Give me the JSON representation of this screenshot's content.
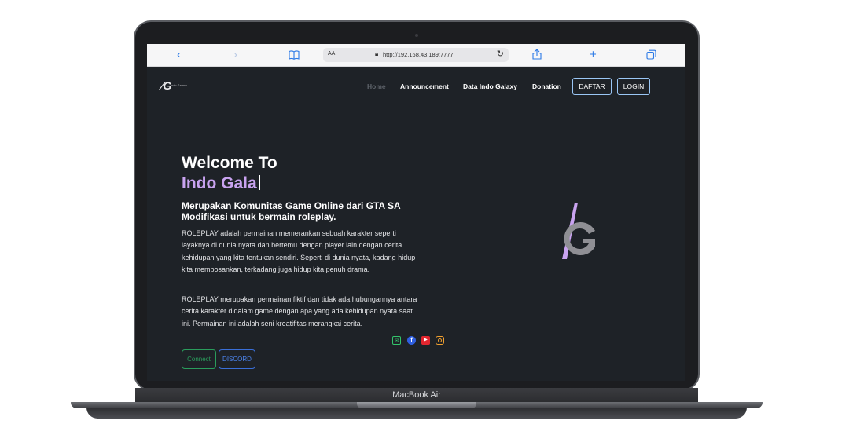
{
  "device": {
    "label": "MacBook Air"
  },
  "browser": {
    "back_icon": "chevron-left-icon",
    "forward_icon": "chevron-right-icon",
    "reader_icon": "book-icon",
    "aa_label": "AA",
    "url": "http://192.168.43.189:7777",
    "lock_icon": "lock-icon",
    "reload_icon": "reload-icon",
    "share_icon": "share-icon",
    "new_tab_icon": "plus-icon",
    "tabs_icon": "tabs-icon"
  },
  "site": {
    "logo_text": "Indo Galaxy",
    "nav": [
      {
        "label": "Home",
        "active": true
      },
      {
        "label": "Announcement",
        "active": false
      },
      {
        "label": "Data Indo Galaxy",
        "active": false
      },
      {
        "label": "Donation",
        "active": false
      }
    ],
    "buttons": {
      "register": "DAFTAR",
      "login": "LOGIN"
    }
  },
  "hero": {
    "welcome": "Welcome To",
    "typed": "Indo Gala",
    "subtitle": "Merupakan Komunitas Game Online dari GTA SA Modifikasi untuk bermain roleplay.",
    "paragraph1": "ROLEPLAY adalah permainan memerankan sebuah karakter seperti layaknya di dunia nyata dan bertemu dengan player lain dengan cerita kehidupan yang kita tentukan sendiri. Seperti di dunia nyata, kadang hidup kita membosankan, terkadang juga hidup kita penuh drama.",
    "paragraph2": "ROLEPLAY merupakan permainan fiktif dan tidak ada hubungannya antara cerita karakter didalam game dengan apa yang ada kehidupan nyata saat ini. Permainan ini adalah seni kreatifitas merangkai cerita.",
    "connect_label": "Connect",
    "discord_label": "DISCORD",
    "social_icons": [
      "mail-icon",
      "facebook-icon",
      "youtube-icon",
      "instagram-icon"
    ]
  },
  "colors": {
    "page_bg": "#1e2227",
    "accent_purple": "#c9a3f0",
    "nav_button_border": "#9ac6f5",
    "connect_green": "#2a9d5c",
    "discord_blue": "#3a6fd8",
    "mail_green": "#33c46b",
    "facebook_blue": "#2f5fe0",
    "youtube_red": "#e3262f",
    "instagram_orange": "#f0a030"
  }
}
